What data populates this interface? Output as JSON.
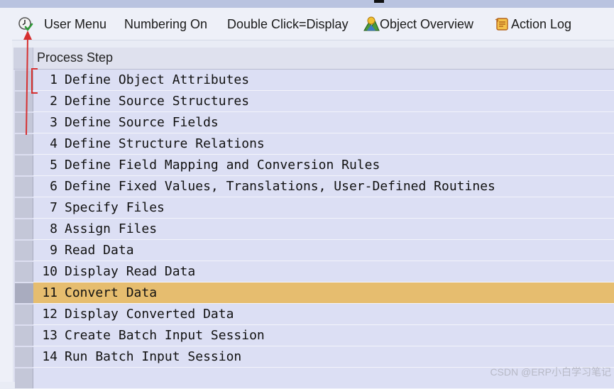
{
  "toolbar": {
    "execute_icon": "execute-clock-check-icon",
    "items": [
      {
        "label": "User Menu"
      },
      {
        "label": "Numbering On"
      },
      {
        "label": "Double Click=Display"
      },
      {
        "label": "Object Overview",
        "icon": "object-overview-icon"
      },
      {
        "label": "Action Log",
        "icon": "action-log-icon"
      }
    ]
  },
  "table": {
    "header": "Process Step",
    "selected_row": 11,
    "rows": [
      {
        "num": "1",
        "step": "Define Object Attributes"
      },
      {
        "num": "2",
        "step": "Define Source Structures"
      },
      {
        "num": "3",
        "step": "Define Source Fields"
      },
      {
        "num": "4",
        "step": "Define Structure Relations"
      },
      {
        "num": "5",
        "step": "Define Field Mapping and Conversion Rules"
      },
      {
        "num": "6",
        "step": "Define Fixed Values, Translations, User-Defined Routines"
      },
      {
        "num": "7",
        "step": "Specify Files"
      },
      {
        "num": "8",
        "step": "Assign Files"
      },
      {
        "num": "9",
        "step": "Read Data"
      },
      {
        "num": "10",
        "step": "Display Read Data"
      },
      {
        "num": "11",
        "step": "Convert Data"
      },
      {
        "num": "12",
        "step": "Display Converted Data"
      },
      {
        "num": "13",
        "step": "Create Batch Input Session"
      },
      {
        "num": "14",
        "step": "Run Batch Input Session"
      }
    ]
  },
  "watermark": "CSDN @ERP小白学习笔记",
  "colors": {
    "selected_row": "#e6bd6f",
    "row_bg": "#dcdff4",
    "annotation_red": "#d63030"
  }
}
